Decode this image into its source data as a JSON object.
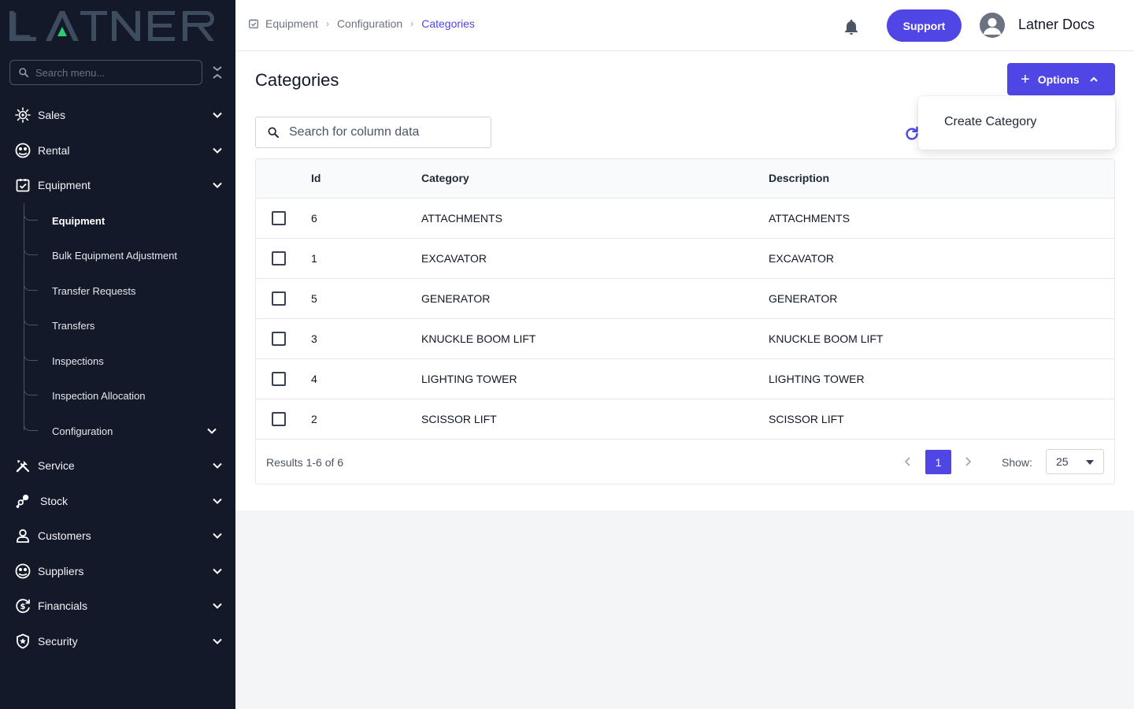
{
  "brand": {
    "name": "LATNER",
    "accent": "#4f46e5",
    "logo_triangle": "#2ecc71"
  },
  "sidebar": {
    "search_placeholder": "Search menu...",
    "items": [
      {
        "label": "Sales",
        "icon": "sales-icon"
      },
      {
        "label": "Rental",
        "icon": "rental-icon"
      },
      {
        "label": "Equipment",
        "icon": "equipment-icon"
      },
      {
        "label": "Service",
        "icon": "service-icon"
      },
      {
        "label": "Stock",
        "icon": "stock-icon"
      },
      {
        "label": "Customers",
        "icon": "customers-icon"
      },
      {
        "label": "Suppliers",
        "icon": "suppliers-icon"
      },
      {
        "label": "Financials",
        "icon": "financials-icon"
      },
      {
        "label": "Security",
        "icon": "security-icon"
      }
    ],
    "equipment_sub": [
      {
        "label": "Equipment"
      },
      {
        "label": "Bulk Equipment Adjustment"
      },
      {
        "label": "Transfer Requests"
      },
      {
        "label": "Transfers"
      },
      {
        "label": "Inspections"
      },
      {
        "label": "Inspection Allocation"
      },
      {
        "label": "Configuration"
      }
    ]
  },
  "header": {
    "breadcrumb": [
      "Equipment",
      "Configuration",
      "Categories"
    ],
    "support_label": "Support",
    "user_name": "Latner Docs"
  },
  "main": {
    "title": "Categories",
    "options_label": "Options",
    "dropdown_items": [
      "Create Category"
    ],
    "search_placeholder": "Search for column data",
    "columns": [
      "Id",
      "Category",
      "Description"
    ],
    "rows": [
      {
        "id": "6",
        "category": "ATTACHMENTS",
        "description": "ATTACHMENTS"
      },
      {
        "id": "1",
        "category": "EXCAVATOR",
        "description": "EXCAVATOR"
      },
      {
        "id": "5",
        "category": "GENERATOR",
        "description": "GENERATOR"
      },
      {
        "id": "3",
        "category": "KNUCKLE BOOM LIFT",
        "description": "KNUCKLE BOOM LIFT"
      },
      {
        "id": "4",
        "category": "LIGHTING TOWER",
        "description": "LIGHTING TOWER"
      },
      {
        "id": "2",
        "category": "SCISSOR LIFT",
        "description": "SCISSOR LIFT"
      }
    ],
    "results_text": "Results 1-6 of 6",
    "current_page": "1",
    "show_label": "Show:",
    "page_size": "25"
  }
}
